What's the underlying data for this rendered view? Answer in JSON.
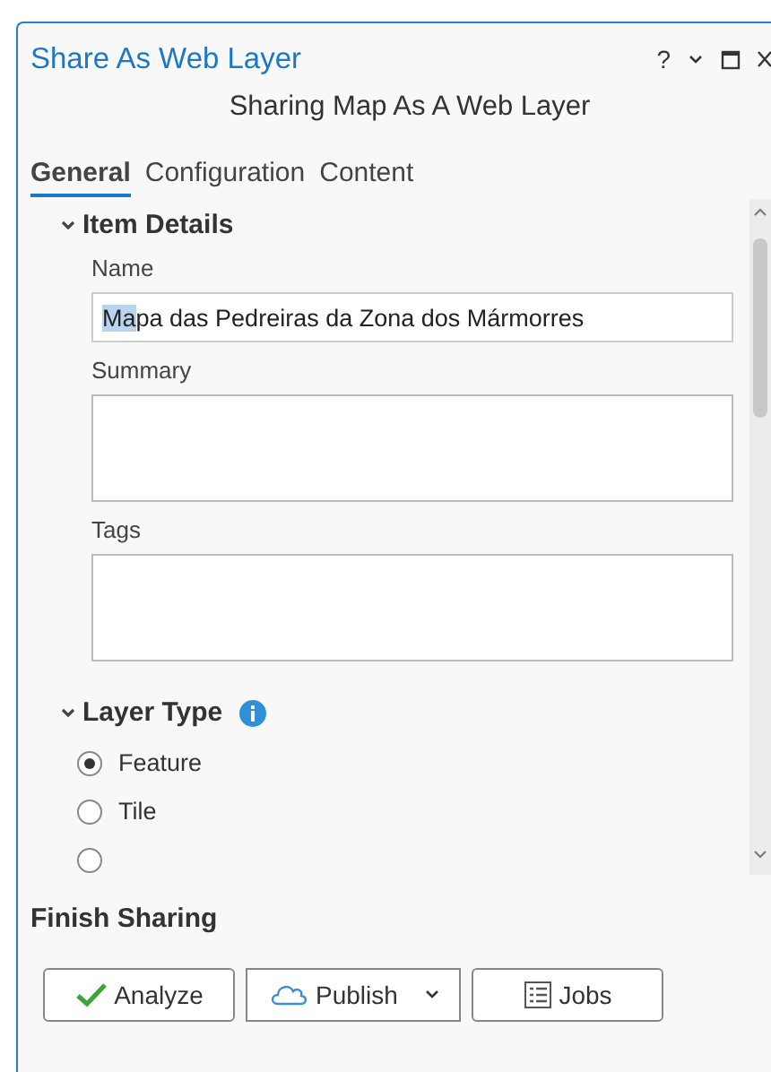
{
  "window": {
    "title": "Share As Web Layer",
    "help": "?"
  },
  "heading": "Sharing Map As A Web Layer",
  "tabs": [
    {
      "label": "General",
      "selected": true
    },
    {
      "label": "Configuration",
      "selected": false
    },
    {
      "label": "Content",
      "selected": false
    }
  ],
  "item_details": {
    "title": "Item Details",
    "expanded": true,
    "fields": [
      {
        "kind": "line",
        "label": "Name",
        "selection": "Ma",
        "rest": "pa das Pedreiras da Zona dos Mármorres"
      },
      {
        "kind": "area",
        "label": "Summary"
      },
      {
        "kind": "area",
        "label": "Tags"
      }
    ]
  },
  "layer_type": {
    "title": "Layer Type",
    "expanded": true,
    "options": [
      {
        "label": "Feature",
        "selected": true
      },
      {
        "label": "Tile",
        "selected": false
      },
      {
        "selected": false
      }
    ]
  },
  "finish_sharing": {
    "title": "Finish Sharing"
  },
  "buttons": [
    {
      "kind": "analyze",
      "label": "Analyze"
    },
    {
      "kind": "publish",
      "label": "Publish"
    },
    {
      "kind": "jobs",
      "label": "Jobs"
    }
  ]
}
